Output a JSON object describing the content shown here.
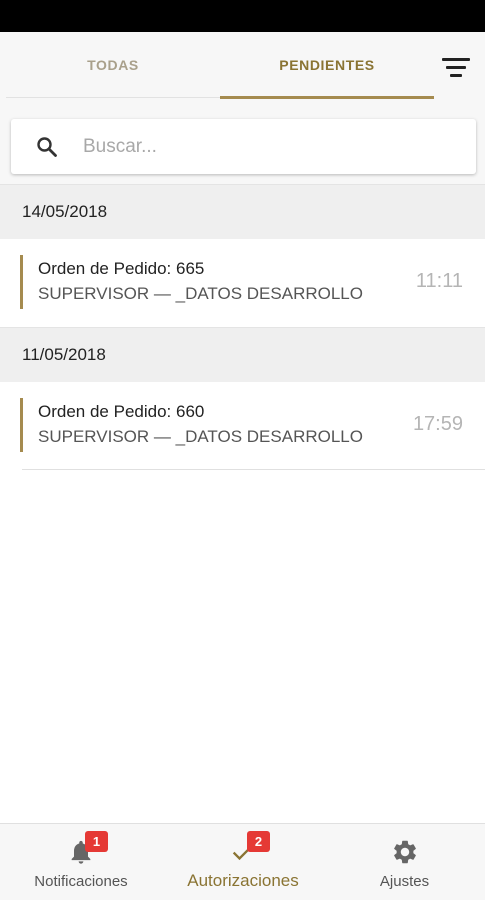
{
  "tabs": [
    {
      "label": "TODAS"
    },
    {
      "label": "PENDIENTES"
    }
  ],
  "active_tab": "PENDIENTES",
  "search": {
    "placeholder": "Buscar...",
    "value": ""
  },
  "groups": [
    {
      "date": "14/05/2018",
      "items": [
        {
          "title": "Orden de Pedido: 665",
          "subtitle": "SUPERVISOR — _DATOS DESARROLLO",
          "time": "11:11"
        }
      ]
    },
    {
      "date": "11/05/2018",
      "items": [
        {
          "title": "Orden de Pedido: 660",
          "subtitle": "SUPERVISOR — _DATOS DESARROLLO",
          "time": "17:59"
        }
      ]
    }
  ],
  "bottom_nav": {
    "notifications": {
      "label": "Notificaciones",
      "badge": "1",
      "icon": "bell-icon"
    },
    "authorizations": {
      "label": "Autorizaciones",
      "badge": "2",
      "icon": "check-icon"
    },
    "settings": {
      "label": "Ajustes",
      "icon": "gear-icon"
    }
  },
  "colors": {
    "accent": "#a58b4f",
    "accent_text": "#8a7433",
    "badge": "#e53935"
  }
}
